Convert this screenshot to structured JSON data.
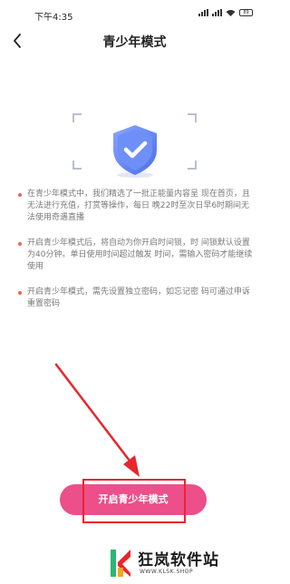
{
  "status_bar": {
    "time": "下午4:35",
    "battery": "89"
  },
  "nav": {
    "title": "青少年模式"
  },
  "rules": [
    "在青少年模式中，我们精选了一批正能量内容呈 现在首页，且无法进行充值，打赏等操作，每日 晚22时至次日早6时期间无法使用奇遇直播",
    "开启青少年模式后，将自动为你开启时间锁，时 间锁默认设置为40分钟。单日使用时间超过触发 时间，需输入密码才能继续使用",
    "开启青少年模式，需先设置独立密码，如忘记密 码可通过申诉重置密码"
  ],
  "start_button": {
    "label": "开启青少年模式"
  },
  "watermark": {
    "brand": "狂岚软件站",
    "url": "WWW.KLSK.SHOP"
  },
  "colors": {
    "accent": "#ec4f8a",
    "bullet": "#f0664e",
    "annotation": "#e8262d",
    "shield": "#5b7ff0"
  }
}
